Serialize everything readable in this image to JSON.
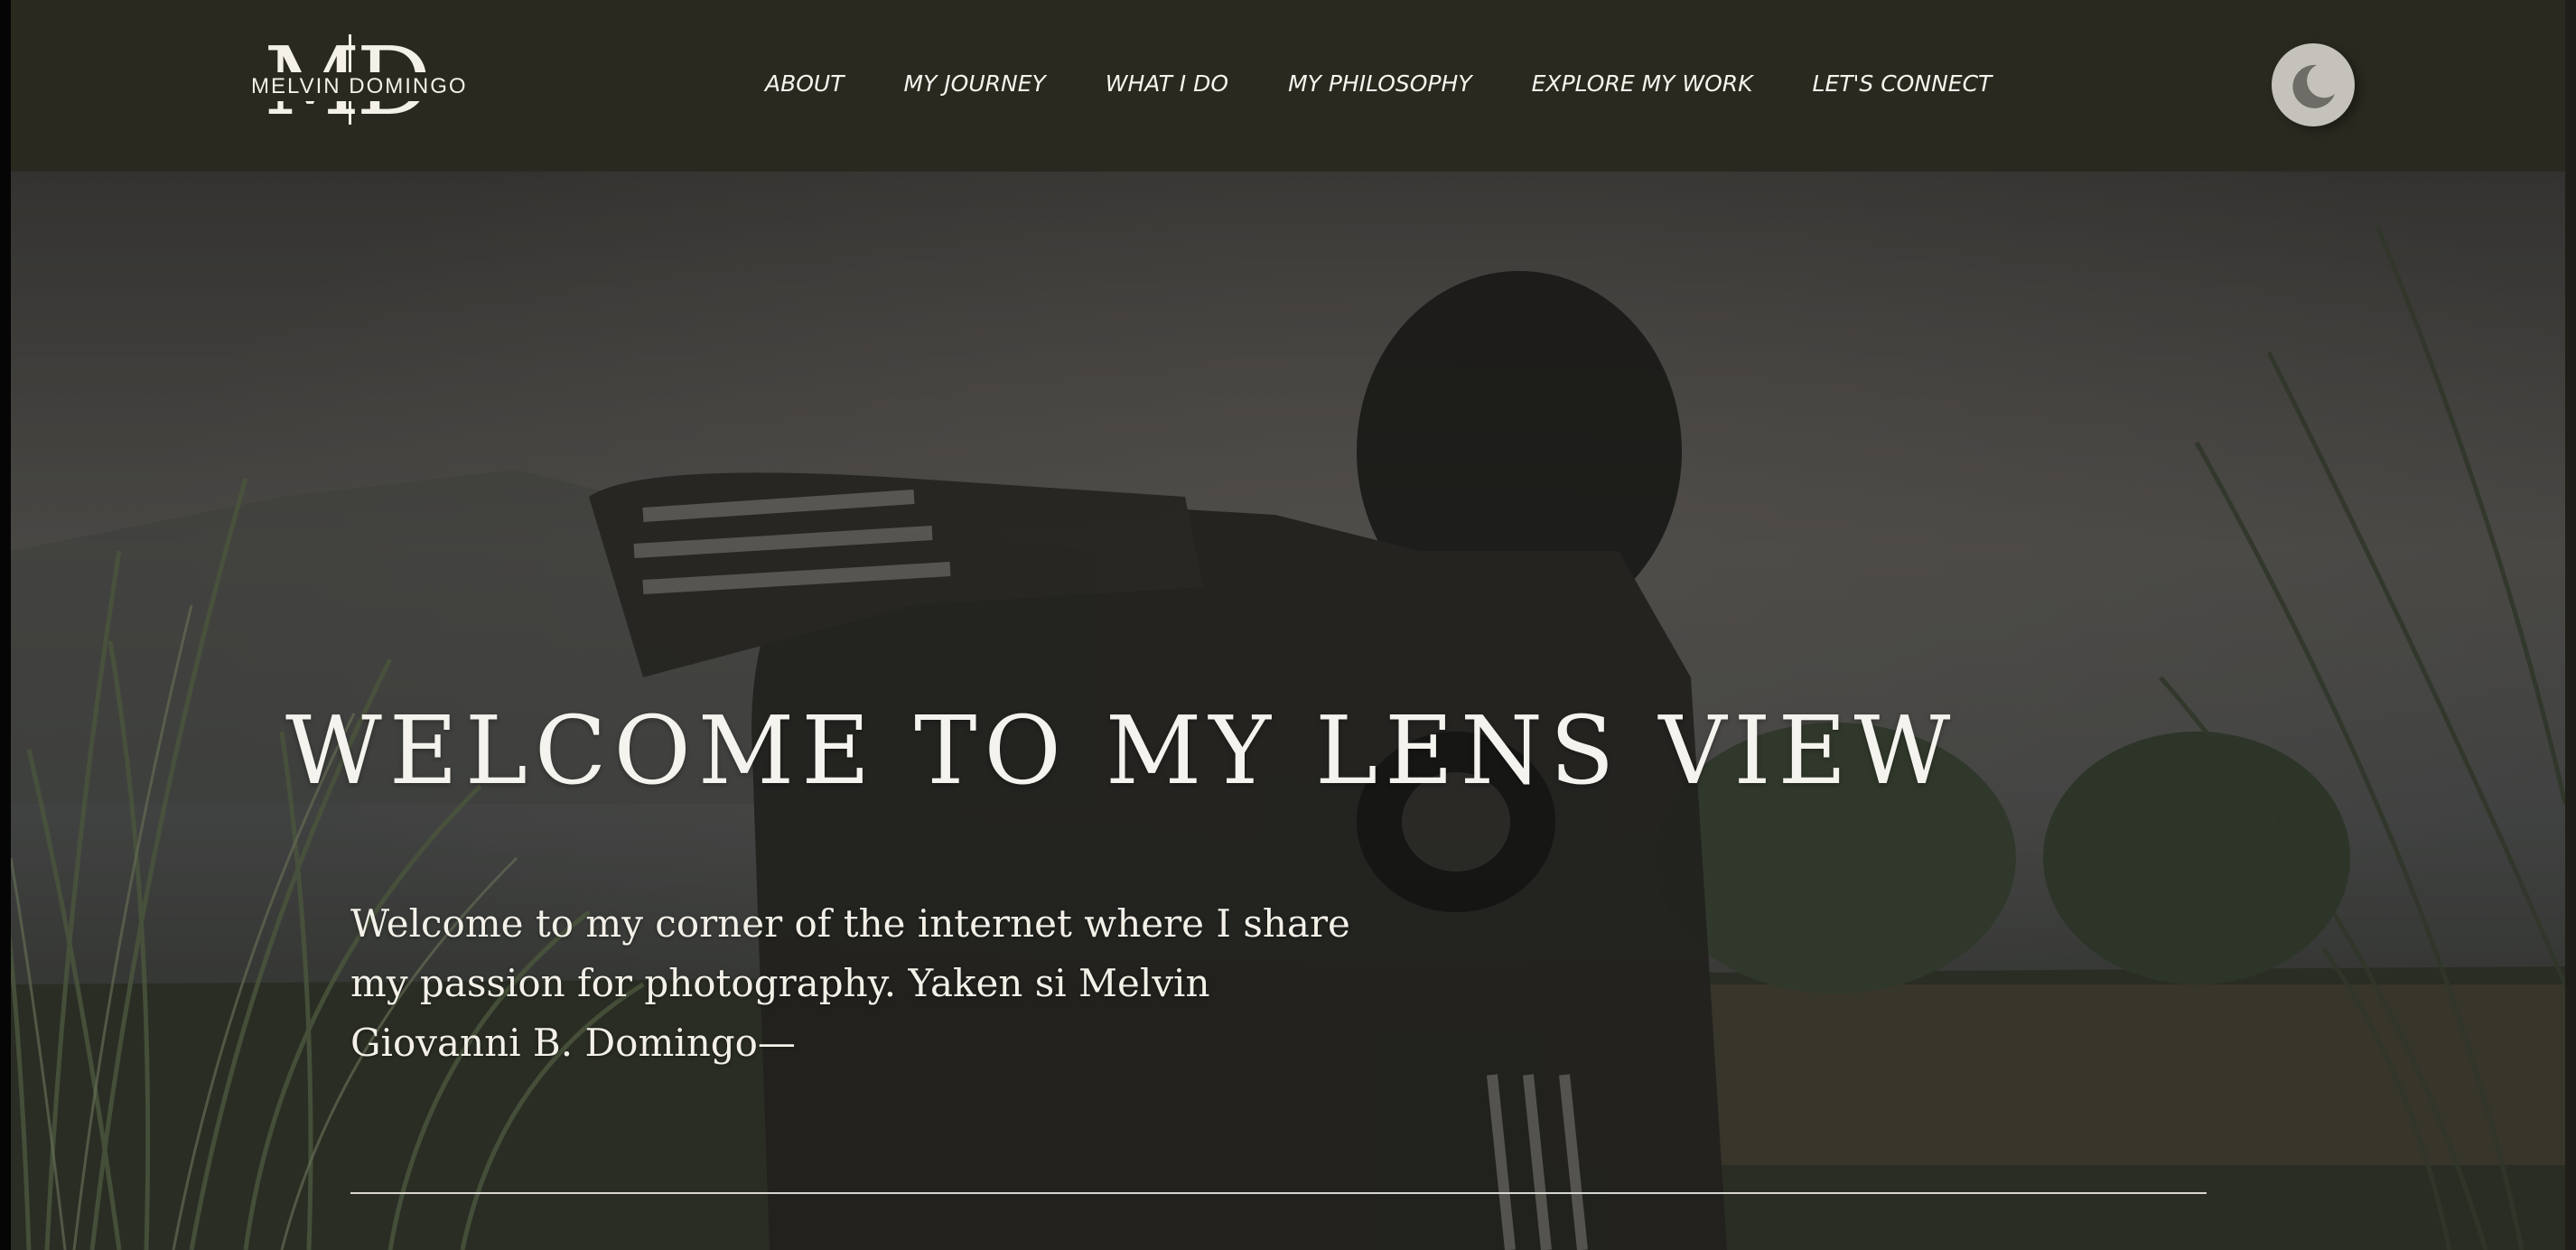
{
  "header": {
    "logo": {
      "monogram": "MD",
      "name": "MELVIN DOMINGO"
    },
    "nav": [
      {
        "label": "ABOUT"
      },
      {
        "label": "MY JOURNEY"
      },
      {
        "label": "WHAT I DO"
      },
      {
        "label": "MY PHILOSOPHY"
      },
      {
        "label": "EXPLORE MY WORK"
      },
      {
        "label": "LET'S CONNECT"
      }
    ],
    "theme_toggle": {
      "icon": "moon-icon"
    }
  },
  "hero": {
    "title": "WELCOME TO MY LENS VIEW",
    "text": "Welcome to my corner of the internet where I share my passion for photography. Yaken si Melvin Giovanni B. Domingo—"
  },
  "colors": {
    "header_bg": "#2a2920",
    "text": "#f5f3ee",
    "toggle_bg": "#c4c2ba",
    "toggle_icon": "#6e6c66"
  }
}
